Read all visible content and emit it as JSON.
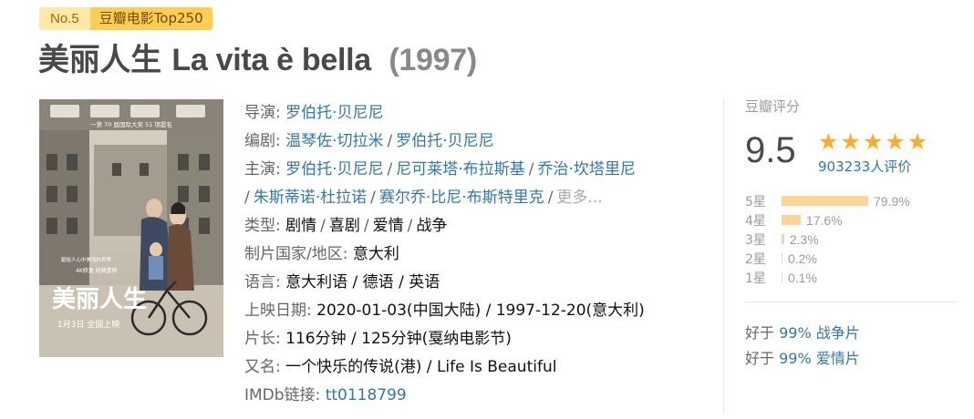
{
  "badge": {
    "rank": "No.5",
    "list": "豆瓣电影Top250"
  },
  "title": {
    "cn": "美丽人生",
    "en": "La vita è bella",
    "year": "(1997)"
  },
  "poster": {
    "stamp_text": "一第 70 届国际大奖 51 项提名",
    "title_art": "美丽人生",
    "tagline_top": "4K修复 经典重映",
    "date": "1月3日 全国上映",
    "small_text": "献给人心中美丽的世界"
  },
  "info": {
    "director_label": "导演",
    "director": "罗伯托·贝尼尼",
    "writer_label": "编剧",
    "writers": [
      "温琴佐·切拉米",
      "罗伯托·贝尼尼"
    ],
    "cast_label": "主演",
    "cast_line1": [
      "罗伯托·贝尼尼",
      "尼可莱塔·布拉斯基",
      "乔治·坎塔里尼"
    ],
    "cast_line2": [
      "朱斯蒂诺·杜拉诺",
      "赛尔乔·比尼·布斯特里克"
    ],
    "more": "更多...",
    "genre_label": "类型",
    "genres": [
      "剧情",
      "喜剧",
      "爱情",
      "战争"
    ],
    "country_label": "制片国家/地区",
    "country": "意大利",
    "language_label": "语言",
    "languages": "意大利语 / 德语 / 英语",
    "release_label": "上映日期",
    "release": "2020-01-03(中国大陆) / 1997-12-20(意大利)",
    "runtime_label": "片长",
    "runtime": "116分钟 / 125分钟(戛纳电影节)",
    "aka_label": "又名",
    "aka": "一个快乐的传说(港) / Life Is Beautiful",
    "imdb_label": "IMDb链接",
    "imdb": "tt0118799"
  },
  "rating": {
    "heading": "豆瓣评分",
    "score": "9.5",
    "stars": 5,
    "votes": "903233人评价",
    "distribution": [
      {
        "label": "5星",
        "pct": "79.9%",
        "value": 79.9
      },
      {
        "label": "4星",
        "pct": "17.6%",
        "value": 17.6
      },
      {
        "label": "3星",
        "pct": "2.3%",
        "value": 2.3
      },
      {
        "label": "2星",
        "pct": "0.2%",
        "value": 0.2
      },
      {
        "label": "1星",
        "pct": "0.1%",
        "value": 0.1
      }
    ],
    "better_than": [
      {
        "prefix": "好于",
        "value": "99% 战争片"
      },
      {
        "prefix": "好于",
        "value": "99% 爱情片"
      }
    ]
  },
  "colors": {
    "link": "#3377aa",
    "star": "#ffac2d",
    "bar": "#ffd596",
    "badge_dark": "#ffcd4f",
    "badge_light": "#ffe9a6"
  }
}
